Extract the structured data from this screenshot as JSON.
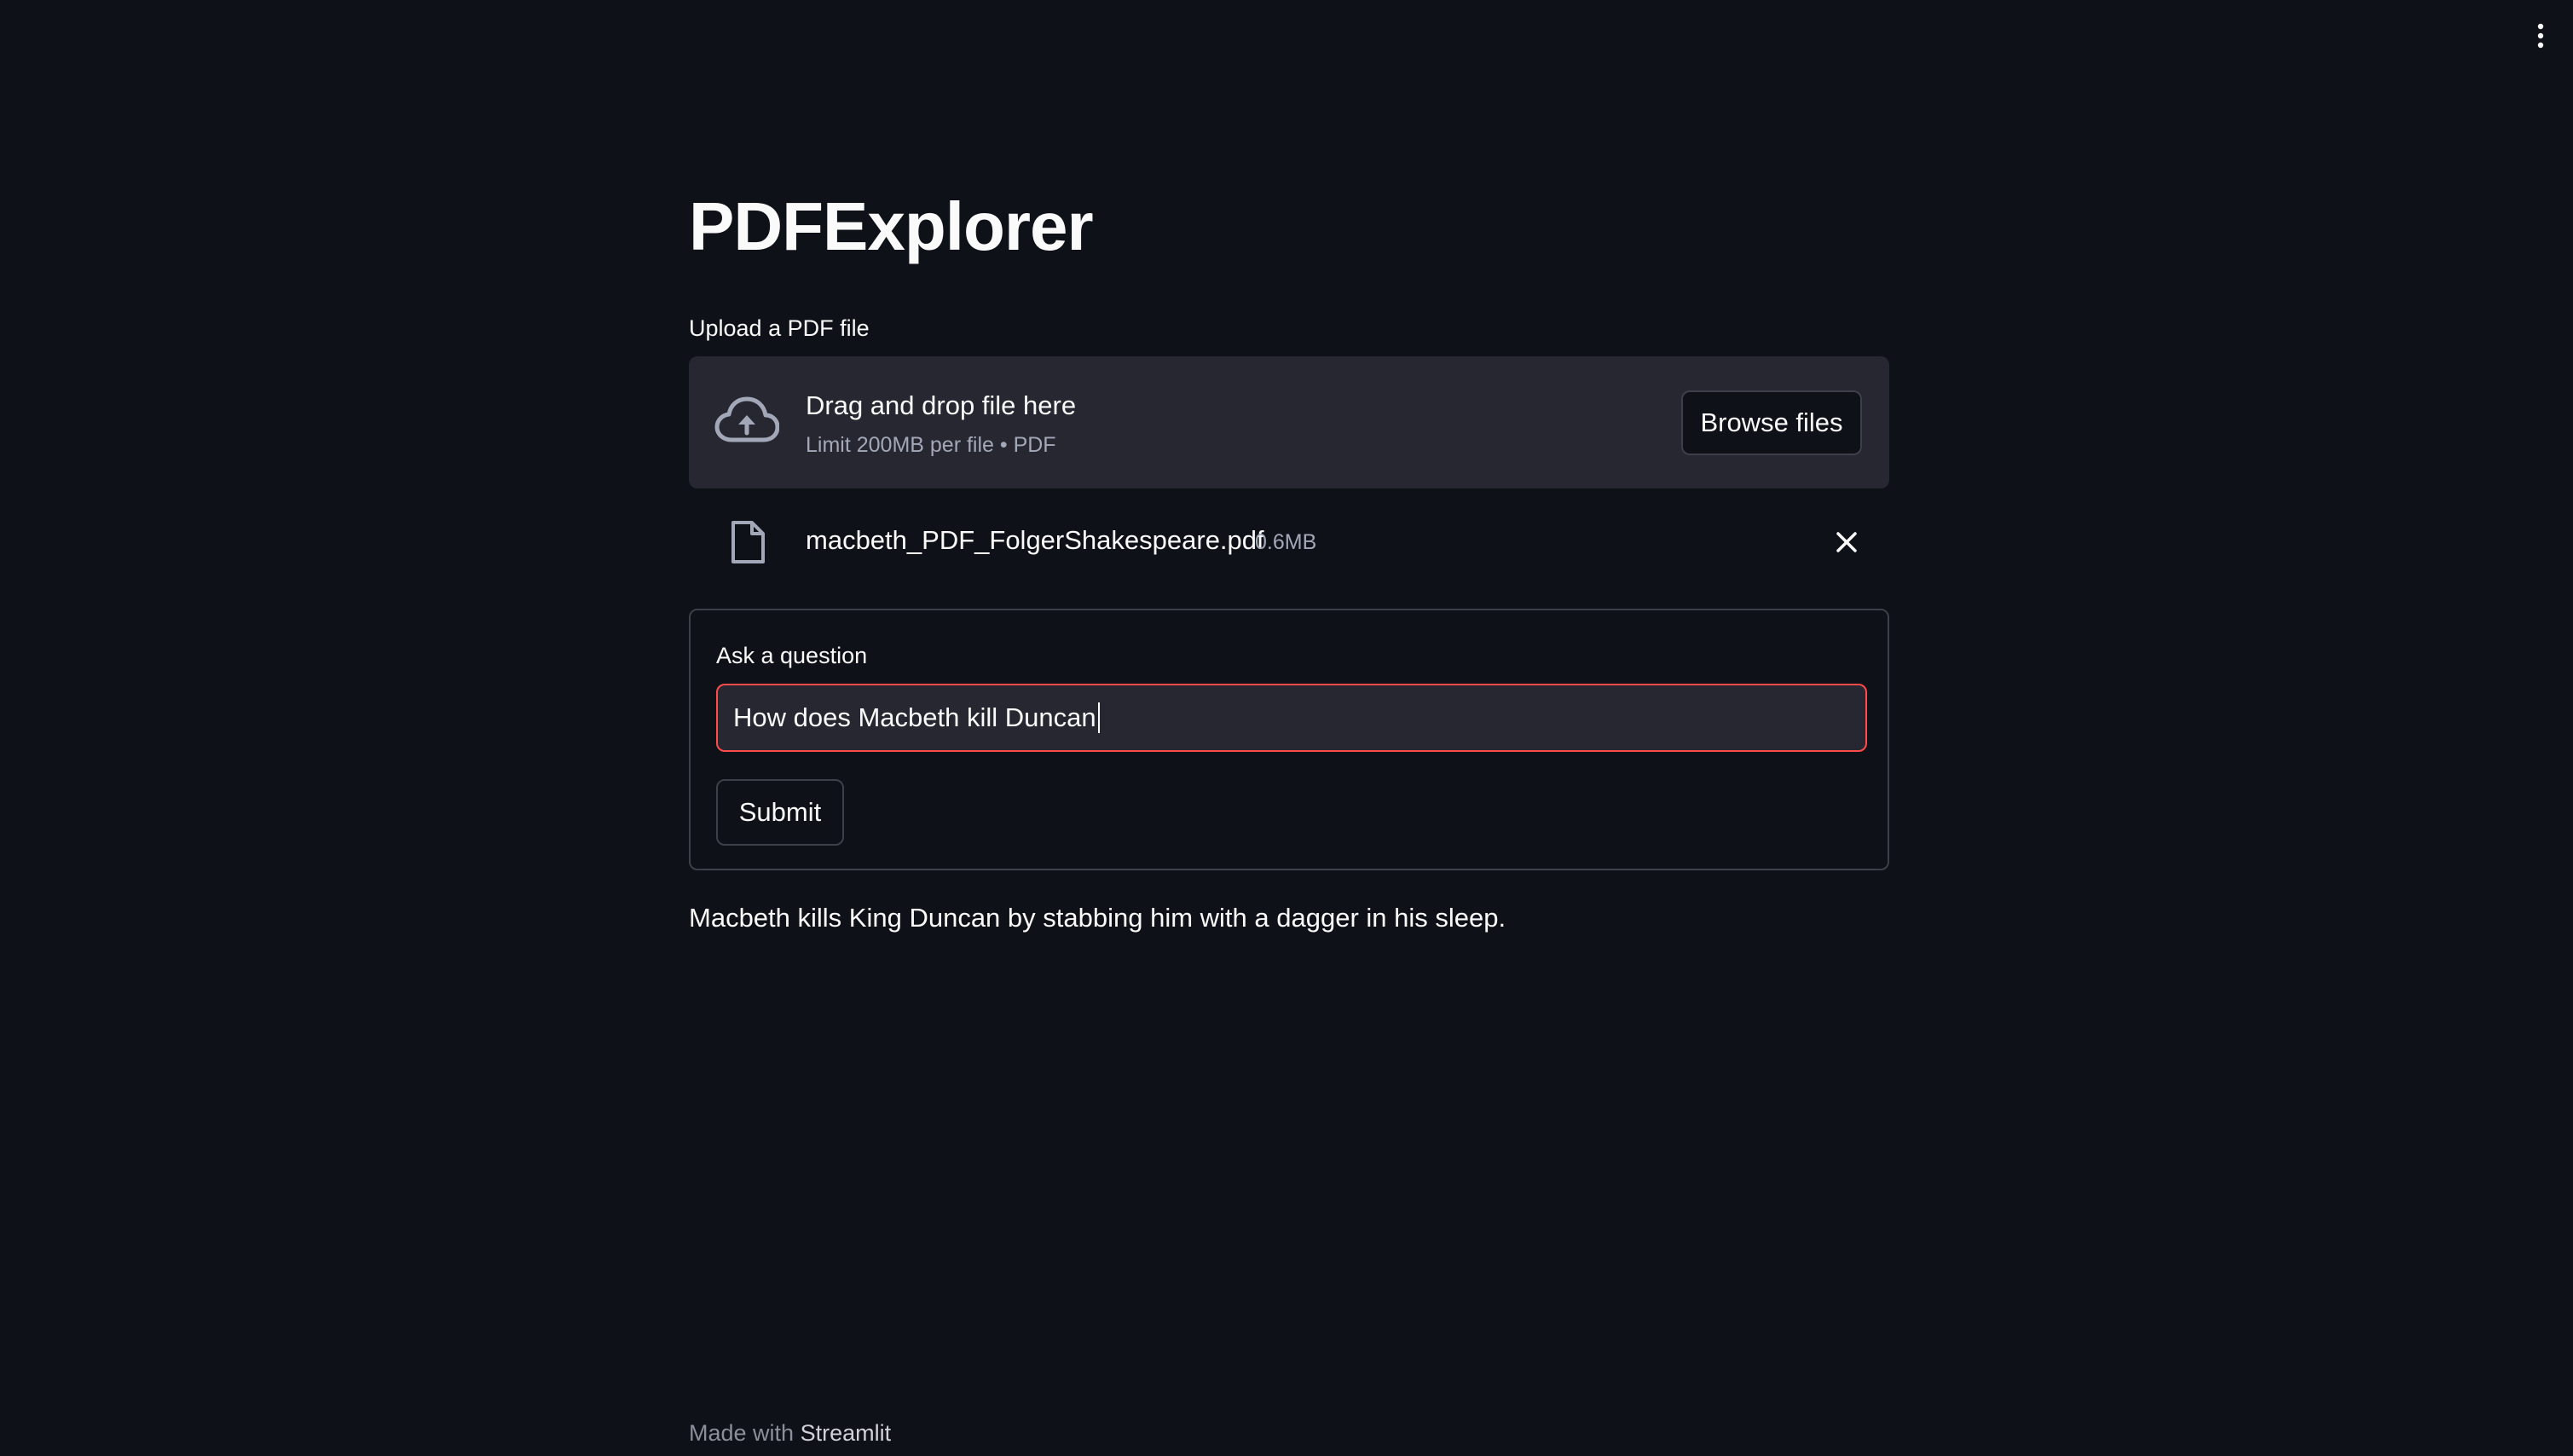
{
  "app": {
    "title": "PDFExplorer",
    "menu_icon": "kebab-menu-icon"
  },
  "uploader": {
    "label": "Upload a PDF file",
    "drop_title": "Drag and drop file here",
    "drop_limit": "Limit 200MB per file • PDF",
    "browse_label": "Browse files",
    "icon": "cloud-upload-icon"
  },
  "uploaded_file": {
    "name": "macbeth_PDF_FolgerShakespeare.pdf",
    "size": "0.6MB",
    "icon": "file-icon",
    "remove_icon": "close-icon"
  },
  "form": {
    "question_label": "Ask a question",
    "question_value": "How does Macbeth kill Duncan",
    "submit_label": "Submit"
  },
  "answer": {
    "text": "Macbeth kills King Duncan by stabbing him with a dagger in his sleep."
  },
  "footer": {
    "prefix": "Made with",
    "link": "Streamlit"
  },
  "colors": {
    "background": "#0e1117",
    "surface": "#262730",
    "accent": "#ff4b4b",
    "text": "#fafafa",
    "muted_text": "#a3a8b8",
    "border": "#3d4048"
  }
}
